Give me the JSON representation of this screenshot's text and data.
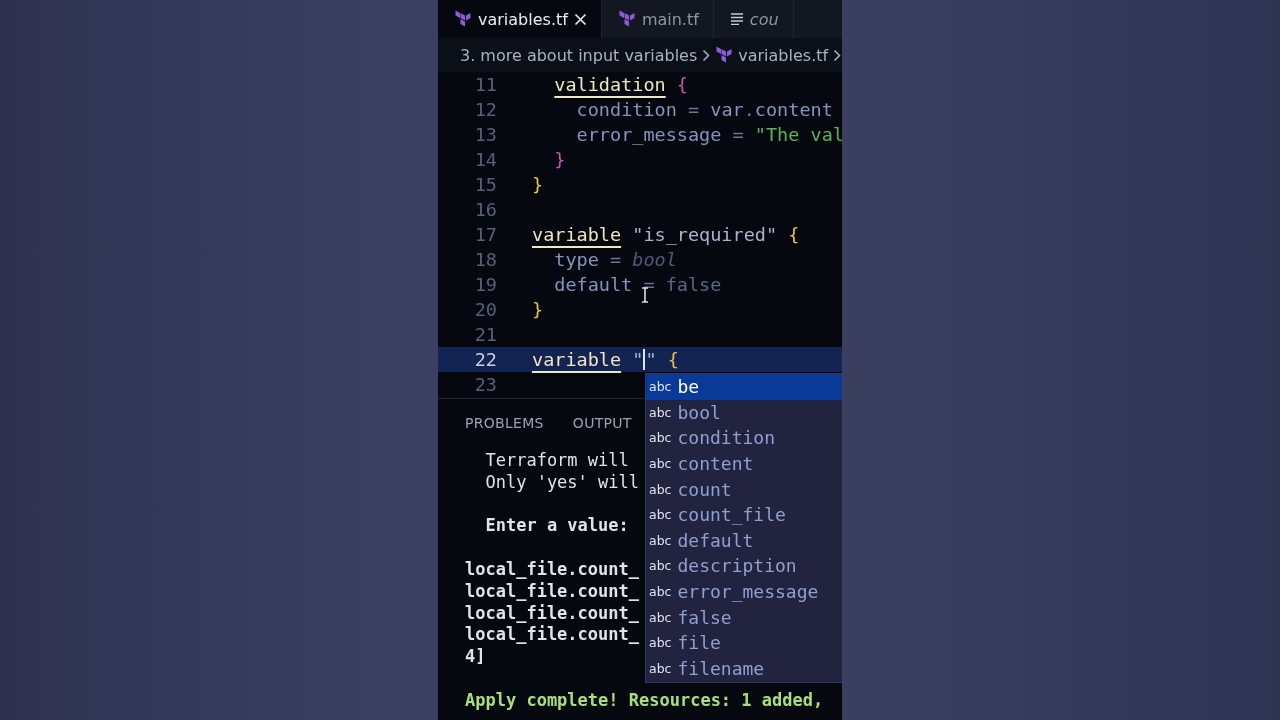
{
  "tabs": [
    {
      "label": "variables.tf",
      "kind": "terraform",
      "selected": true,
      "closable": true
    },
    {
      "label": "main.tf",
      "kind": "terraform",
      "selected": false,
      "closable": false
    },
    {
      "label": "cou",
      "kind": "text",
      "selected": false,
      "closable": false
    }
  ],
  "breadcrumb": [
    {
      "label": "3. more about input variables",
      "kind": "folder"
    },
    {
      "label": "variables.tf",
      "kind": "terraform"
    }
  ],
  "editor": {
    "lines": [
      {
        "number": "11",
        "kind": "inner",
        "highlighted": false,
        "tokens": [
          {
            "text": "validation",
            "kind": "keyword"
          },
          {
            "text": " {",
            "kind": "brace2"
          }
        ]
      },
      {
        "number": "12",
        "kind": "nested",
        "highlighted": false,
        "tokens": [
          {
            "text": "condition",
            "kind": "attr"
          },
          {
            "text": " = ",
            "kind": "op"
          },
          {
            "text": "var",
            "kind": "attr"
          },
          {
            "text": ".",
            "kind": "op"
          },
          {
            "text": "content",
            "kind": "attr"
          }
        ]
      },
      {
        "number": "13",
        "kind": "nested",
        "highlighted": false,
        "tokens": [
          {
            "text": "error_message",
            "kind": "attr"
          },
          {
            "text": " = ",
            "kind": "op"
          },
          {
            "text": "\"The val",
            "kind": "green"
          }
        ]
      },
      {
        "number": "14",
        "kind": "inner",
        "highlighted": false,
        "tokens": [
          {
            "text": "}",
            "kind": "brace2"
          }
        ]
      },
      {
        "number": "15",
        "kind": "top",
        "highlighted": false,
        "tokens": [
          {
            "text": "}",
            "kind": "brace"
          }
        ]
      },
      {
        "number": "16",
        "highlighted": false
      },
      {
        "number": "17",
        "kind": "top",
        "highlighted": false,
        "tokens": [
          {
            "text": "variable",
            "kind": "keyword"
          },
          {
            "text": " \"is_required\"",
            "kind": "string"
          },
          {
            "text": " {",
            "kind": "brace"
          }
        ]
      },
      {
        "number": "18",
        "kind": "inner",
        "highlighted": false,
        "tokens": [
          {
            "text": "type",
            "kind": "attr"
          },
          {
            "text": " = ",
            "kind": "op"
          },
          {
            "text": "bool",
            "kind": "type"
          }
        ]
      },
      {
        "number": "19",
        "kind": "inner",
        "highlighted": false,
        "tokens": [
          {
            "text": "default",
            "kind": "attr"
          },
          {
            "text": " = ",
            "kind": "op"
          },
          {
            "text": "false",
            "kind": "value"
          }
        ]
      },
      {
        "number": "20",
        "kind": "top",
        "highlighted": false,
        "tokens": [
          {
            "text": "}",
            "kind": "brace"
          }
        ]
      },
      {
        "number": "21",
        "highlighted": false
      },
      {
        "number": "22",
        "kind": "top",
        "highlighted": true,
        "tokens": [
          {
            "text": "variable",
            "kind": "keyword"
          },
          {
            "text": " \"",
            "kind": "string"
          },
          {
            "kind": "cursor"
          },
          {
            "text": "\"",
            "kind": "string"
          },
          {
            "text": " {",
            "kind": "brace"
          }
        ]
      },
      {
        "number": "23",
        "highlighted": false
      }
    ]
  },
  "panel": {
    "tabs": [
      {
        "label": "PROBLEMS"
      },
      {
        "label": "OUTPUT"
      }
    ],
    "terminal": [
      {
        "text": "  Terraform will",
        "kind": "normal"
      },
      {
        "text": "  Only 'yes' will",
        "kind": "normal"
      },
      {
        "kind": "blank"
      },
      {
        "text": "  Enter a value:",
        "kind": "bold"
      },
      {
        "kind": "blank"
      },
      {
        "text": "local_file.count_",
        "kind": "bold"
      },
      {
        "text": "local_file.count_",
        "kind": "bold"
      },
      {
        "text": "local_file.count_",
        "kind": "bold"
      },
      {
        "text": "local_file.count_",
        "kind": "bold"
      },
      {
        "text": "4]",
        "kind": "bold"
      },
      {
        "kind": "blank"
      },
      {
        "text": "Apply complete! Resources: 1 added,",
        "kind": "success"
      }
    ]
  },
  "suggestions": [
    {
      "tag": "abc",
      "label": "be",
      "selected": true
    },
    {
      "tag": "abc",
      "label": "bool",
      "selected": false
    },
    {
      "tag": "abc",
      "label": "condition",
      "selected": false
    },
    {
      "tag": "abc",
      "label": "content",
      "selected": false
    },
    {
      "tag": "abc",
      "label": "count",
      "selected": false
    },
    {
      "tag": "abc",
      "label": "count_file",
      "selected": false
    },
    {
      "tag": "abc",
      "label": "default",
      "selected": false
    },
    {
      "tag": "abc",
      "label": "description",
      "selected": false
    },
    {
      "tag": "abc",
      "label": "error_message",
      "selected": false
    },
    {
      "tag": "abc",
      "label": "false",
      "selected": false
    },
    {
      "tag": "abc",
      "label": "file",
      "selected": false
    },
    {
      "tag": "abc",
      "label": "filename",
      "selected": false
    }
  ]
}
